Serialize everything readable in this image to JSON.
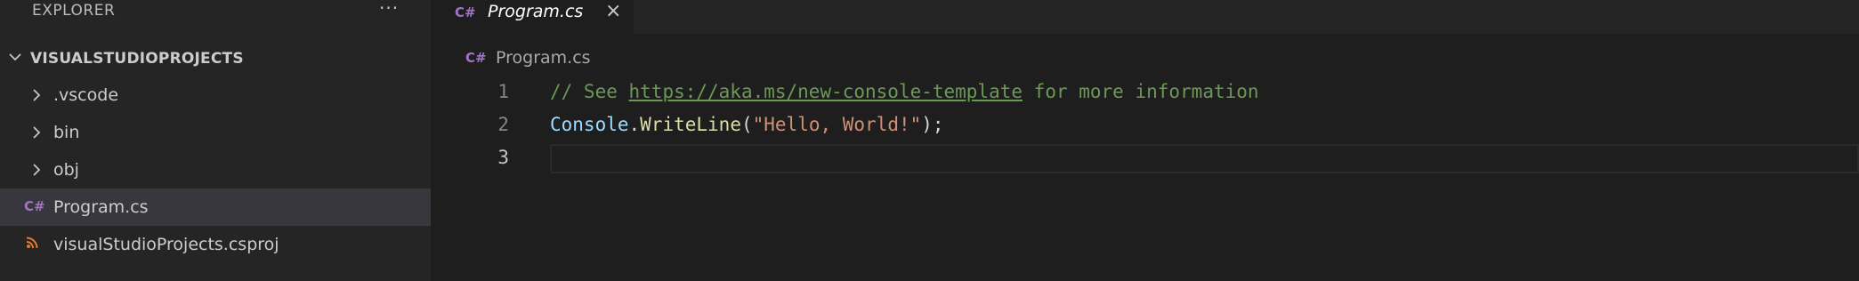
{
  "explorer": {
    "title": "EXPLORER",
    "more": "···",
    "folder": "VISUALSTUDIOPROJECTS",
    "items": [
      {
        "label": ".vscode",
        "kind": "folder"
      },
      {
        "label": "bin",
        "kind": "folder"
      },
      {
        "label": "obj",
        "kind": "folder"
      },
      {
        "label": "Program.cs",
        "kind": "csharp-file",
        "selected": true
      },
      {
        "label": "visualStudioProjects.csproj",
        "kind": "project-file"
      }
    ]
  },
  "icons": {
    "csharp": "C#",
    "folder_chevron": "chevron-right-icon",
    "root_chevron": "chevron-down-icon",
    "project": "rss-icon"
  },
  "editor": {
    "tab": {
      "label": "Program.cs",
      "close": "×"
    },
    "breadcrumb": "Program.cs",
    "lines": [
      {
        "num": "1",
        "comment_start": "// See ",
        "link": "https://aka.ms/new-console-template",
        "comment_end": " for more information"
      },
      {
        "num": "2",
        "type": "Console",
        "dot": ".",
        "func": "WriteLine",
        "open": "(",
        "string": "\"Hello, World!\"",
        "close": ");"
      },
      {
        "num": "3"
      }
    ]
  },
  "colors": {
    "accent_csharp": "#a074c4",
    "comment": "#6a9955",
    "string": "#ce9178",
    "function": "#dcdcaa",
    "variable": "#9cdcfe"
  }
}
